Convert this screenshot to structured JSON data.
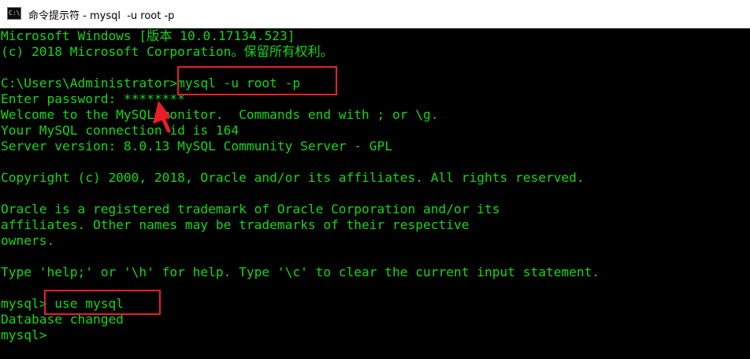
{
  "window": {
    "title": "命令提示符 - mysql  -u root -p",
    "icon": "cmd-icon",
    "icon_glyph": "C:\\"
  },
  "terminal": {
    "text_color": "#13d713",
    "background": "#000000",
    "lines": [
      "Microsoft Windows [版本 10.0.17134.523]",
      "(c) 2018 Microsoft Corporation。保留所有权利。",
      "",
      "C:\\Users\\Administrator>mysql -u root -p",
      "Enter password: ********",
      "Welcome to the MySQL monitor.  Commands end with ; or \\g.",
      "Your MySQL connection id is 164",
      "Server version: 8.0.13 MySQL Community Server - GPL",
      "",
      "Copyright (c) 2000, 2018, Oracle and/or its affiliates. All rights reserved.",
      "",
      "Oracle is a registered trademark of Oracle Corporation and/or its",
      "affiliates. Other names may be trademarks of their respective",
      "owners.",
      "",
      "Type 'help;' or '\\h' for help. Type '\\c' to clear the current input statement.",
      "",
      "mysql> use mysql",
      "Database changed",
      "mysql>"
    ]
  },
  "annotations": {
    "color": "#e81e2a"
  }
}
